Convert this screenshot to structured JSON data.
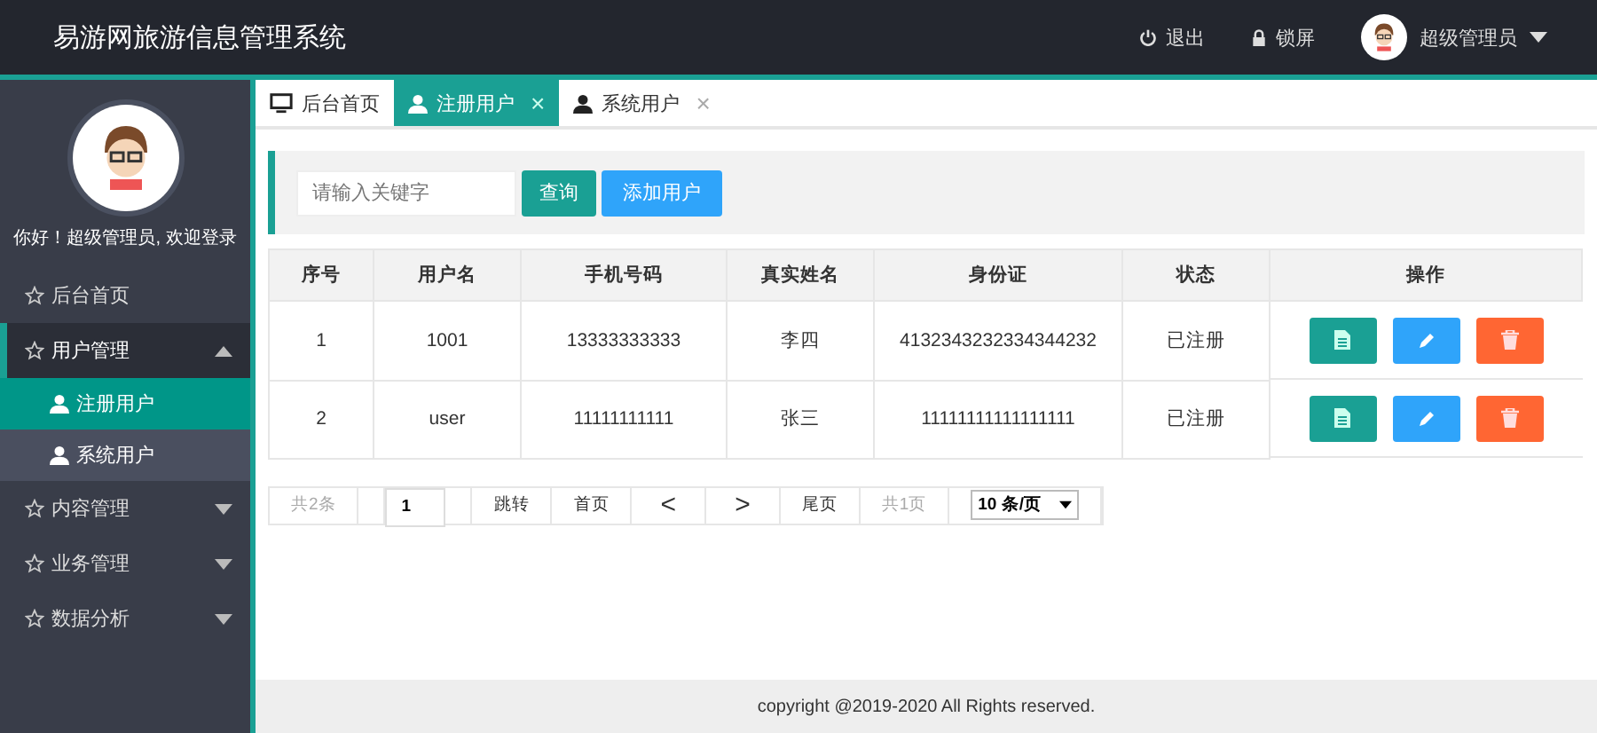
{
  "header": {
    "title": "易游网旅游信息管理系统",
    "actions": [
      {
        "kind": "power",
        "label": "退出"
      },
      {
        "kind": "lock",
        "label": "锁屏"
      }
    ],
    "user": {
      "name": "超级管理员"
    }
  },
  "sidebar": {
    "greeting": "你好！超级管理员, 欢迎登录",
    "items": [
      {
        "label": "后台首页",
        "selected": false
      },
      {
        "label": "用户管理",
        "selected": true,
        "expanded": true,
        "children": [
          {
            "label": "注册用户",
            "selected": true
          },
          {
            "label": "系统用户",
            "selected": false
          }
        ]
      },
      {
        "label": "内容管理",
        "selected": false,
        "expanded": false
      },
      {
        "label": "业务管理",
        "selected": false,
        "expanded": false
      },
      {
        "label": "数据分析",
        "selected": false,
        "expanded": false
      }
    ]
  },
  "tabs": [
    {
      "kind": "monitor",
      "label": "后台首页",
      "selected": false
    },
    {
      "kind": "user",
      "label": "注册用户",
      "selected": true,
      "close": "×"
    },
    {
      "kind": "user",
      "label": "系统用户",
      "selected": false,
      "close": "×"
    }
  ],
  "search": {
    "placeholder": "请输入关键字",
    "buttons": [
      "查询",
      "添加用户"
    ]
  },
  "table": {
    "columns": [
      "序号",
      "用户名",
      "手机号码",
      "真实姓名",
      "身份证",
      "状态",
      "操作"
    ],
    "rows": [
      [
        "1",
        "1001",
        "13333333333",
        "李四",
        "4132343232334344232",
        "已注册"
      ],
      [
        "2",
        "user",
        "11111111111",
        "张三",
        "11111111111111111",
        "已注册"
      ]
    ]
  },
  "pagination": {
    "total": "共2条",
    "page": "1",
    "jump": "跳转",
    "first": "首页",
    "prev": "<",
    "next": ">",
    "last": "尾页",
    "pages": "共1页",
    "page_size": "10 条/页"
  },
  "footer": "copyright @2019-2020 All Rights reserved."
}
